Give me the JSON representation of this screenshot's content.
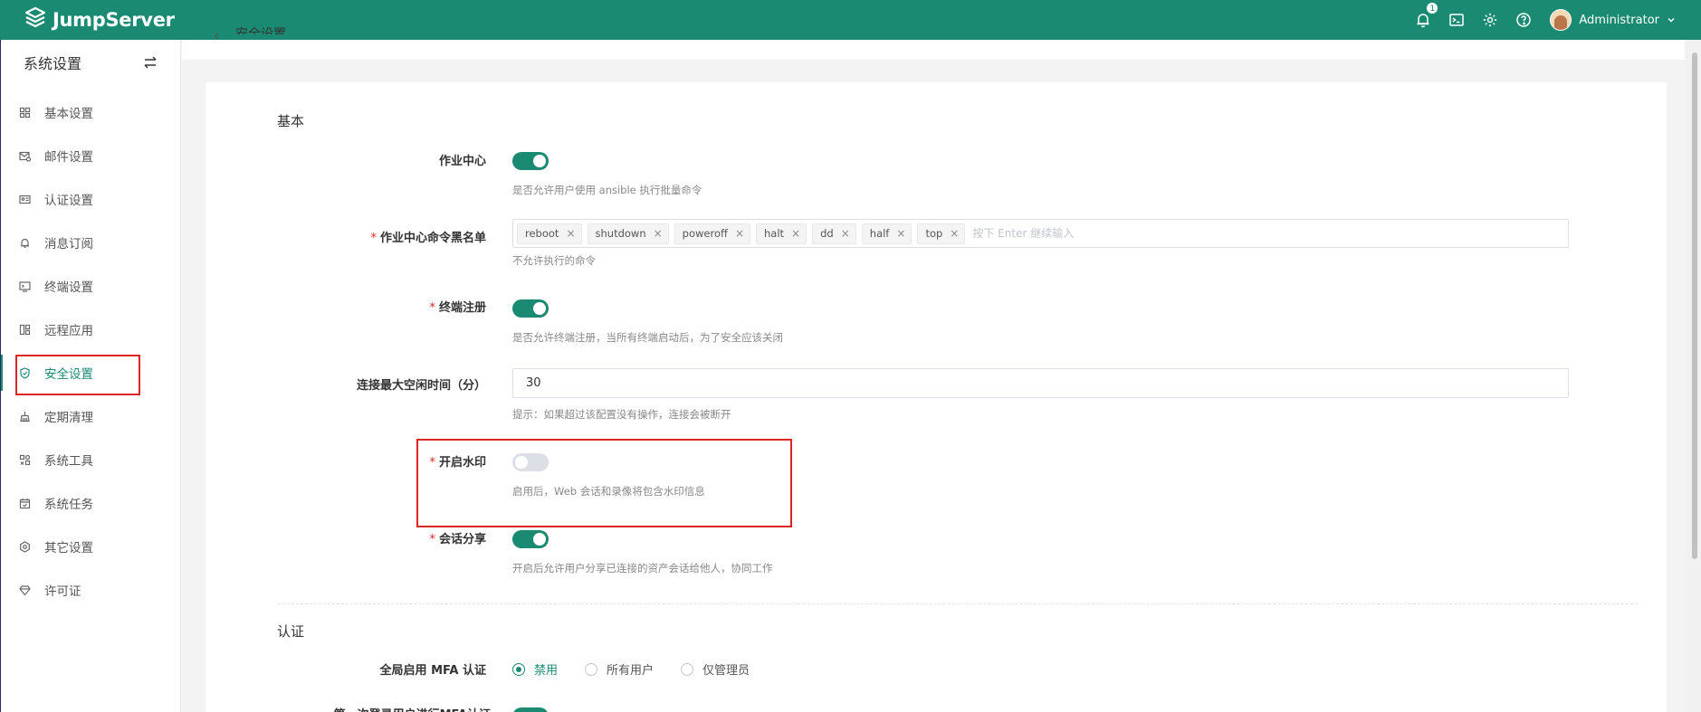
{
  "app": {
    "name": "JumpServer",
    "brand_color": "#1a8a72"
  },
  "header": {
    "notification_count": "1",
    "user_name": "Administrator",
    "icons": [
      "bell-icon",
      "terminal-icon",
      "gear-icon",
      "help-icon"
    ]
  },
  "sidebar": {
    "title": "系统设置",
    "items": [
      {
        "label": "基本设置",
        "icon": "grid-icon"
      },
      {
        "label": "邮件设置",
        "icon": "mail-icon"
      },
      {
        "label": "认证设置",
        "icon": "id-card-icon"
      },
      {
        "label": "消息订阅",
        "icon": "bell-icon"
      },
      {
        "label": "终端设置",
        "icon": "monitor-icon"
      },
      {
        "label": "远程应用",
        "icon": "apps-icon"
      },
      {
        "label": "安全设置",
        "icon": "shield-icon",
        "active": true
      },
      {
        "label": "定期清理",
        "icon": "broom-icon"
      },
      {
        "label": "系统工具",
        "icon": "tools-icon"
      },
      {
        "label": "系统任务",
        "icon": "calendar-icon"
      },
      {
        "label": "其它设置",
        "icon": "settings-icon"
      },
      {
        "label": "许可证",
        "icon": "diamond-icon"
      }
    ]
  },
  "breadcrumb": {
    "text": "安全设置"
  },
  "sections": {
    "basic": {
      "title": "基本",
      "job_center": {
        "label": "作业中心",
        "enabled": true,
        "hint": "是否允许用户使用 ansible 执行批量命令"
      },
      "blacklist": {
        "label": "作业中心命令黑名单",
        "tags": [
          "reboot",
          "shutdown",
          "poweroff",
          "halt",
          "dd",
          "half",
          "top"
        ],
        "placeholder": "按下 Enter 继续输入",
        "hint": "不允许执行的命令"
      },
      "terminal_register": {
        "label": "终端注册",
        "enabled": true,
        "hint": "是否允许终端注册，当所有终端启动后，为了安全应该关闭"
      },
      "idle_timeout": {
        "label": "连接最大空闲时间（分）",
        "value": "30",
        "hint": "提示：如果超过该配置没有操作，连接会被断开"
      },
      "watermark": {
        "label": "开启水印",
        "enabled": false,
        "hint": "启用后，Web 会话和录像将包含水印信息"
      },
      "session_share": {
        "label": "会话分享",
        "enabled": true,
        "hint": "开启后允许用户分享已连接的资产会话给他人，协同工作"
      }
    },
    "auth": {
      "title": "认证",
      "mfa": {
        "label": "全局启用 MFA 认证",
        "options": [
          "禁用",
          "所有用户",
          "仅管理员"
        ],
        "selected": "禁用"
      },
      "next_label": "第一次登录用户进行MFA认证"
    }
  }
}
